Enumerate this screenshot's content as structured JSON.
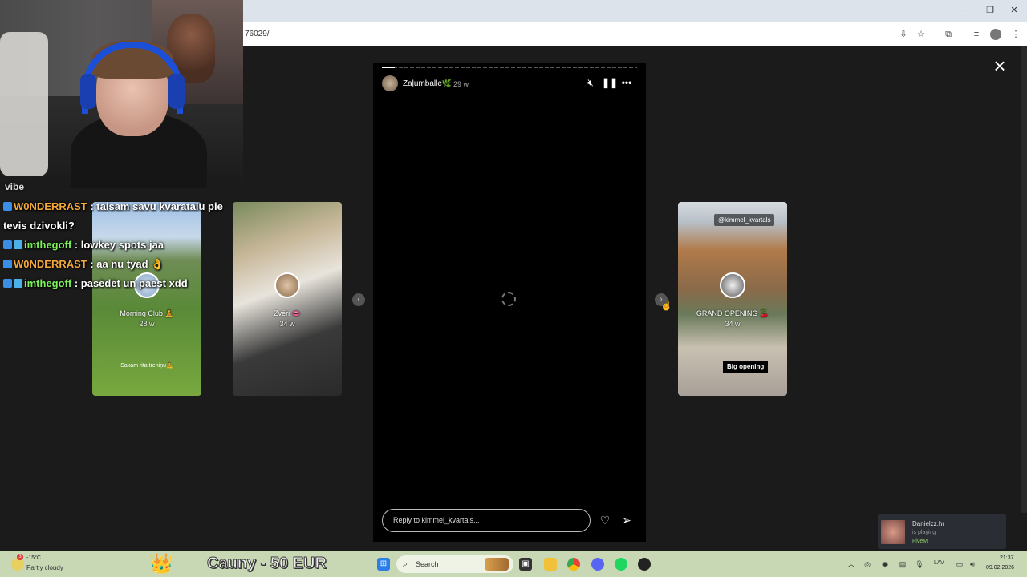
{
  "browser": {
    "url": "76029/"
  },
  "chat": {
    "partial_top": "vibe",
    "messages": [
      {
        "user": "W0NDERRAST",
        "user_color": "#f4a83a",
        "text": " : taisam savu kvaratalu pie tevis dzivokli?"
      },
      {
        "user": "imthegoff",
        "user_color": "#7cf25a",
        "text": " : lowkey spots jaa"
      },
      {
        "user": "W0NDERRAST",
        "user_color": "#f4a83a",
        "text": " : aa nu tyad 👌"
      },
      {
        "user": "imthegoff",
        "user_color": "#7cf25a",
        "text": " : pasēdēt un paest xdd"
      }
    ]
  },
  "thumbs": [
    {
      "name": "Morning Club 🧘",
      "time": "28 w",
      "caption": "Sakam rita treniņu🧘"
    },
    {
      "name": "Zvēri 👄",
      "time": "34 w"
    },
    {
      "name": "GRAND OPENING 🍒",
      "time": "34 w",
      "tag": "@kimmel_kvartals",
      "sticker": "Big opening"
    }
  ],
  "story": {
    "username": "Zaļumballe🌿",
    "time": "29 w",
    "reply_placeholder": "Reply to kimmel_kvartals...",
    "progress": 0.05
  },
  "notification": {
    "name": "Danielzz.hr",
    "status": "is playing",
    "game": "FiveM"
  },
  "taskbar": {
    "weather_temp": "-15°C",
    "weather_desc": "Partly cloudy",
    "weather_badge": "3",
    "donation": "Cauny - 50 EUR",
    "search_placeholder": "Search",
    "lang": "LAV",
    "time": "21:37",
    "date": "09.02.2026"
  }
}
